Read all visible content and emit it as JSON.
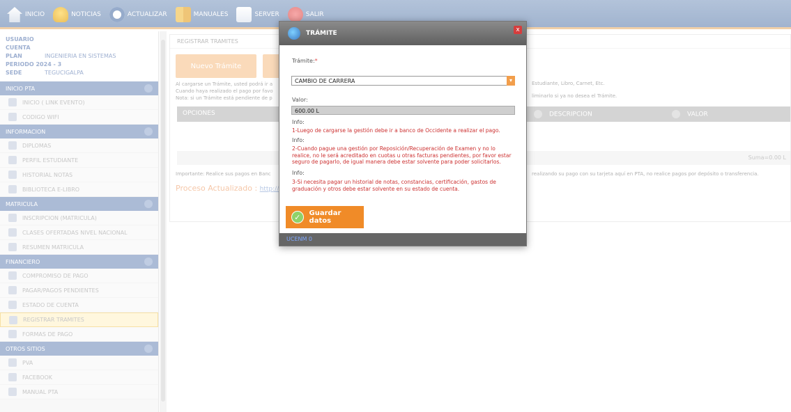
{
  "nav": {
    "inicio": "INICIO",
    "noticias": "NOTICIAS",
    "actualizar": "ACTUALIZAR",
    "manuales": "MANUALES",
    "server": "SERVER",
    "salir": "SALIR"
  },
  "user": {
    "usuario": "USUARIO",
    "cuenta": "CUENTA",
    "plan_label": "PLAN",
    "plan_value": "INGENIERIA EN SISTEMAS",
    "periodo": "PERIODO 2024 - 3",
    "sede_label": "SEDE",
    "sede_value": "TEGUCIGALPA"
  },
  "sidebar": {
    "sections": [
      {
        "title": "INICIO PTA",
        "items": [
          "INICIO ( LINK EVENTO)",
          "CODIGO WIFI"
        ]
      },
      {
        "title": "INFORMACION",
        "items": [
          "DIPLOMAS",
          "PERFIL ESTUDIANTE",
          "HISTORIAL NOTAS",
          "BIBLIOTECA E-LIBRO"
        ]
      },
      {
        "title": "MATRICULA",
        "items": [
          "INSCRIPCION (MATRICULA)",
          "CLASES OFERTADAS NIVEL NACIONAL",
          "RESUMEN MATRICULA"
        ]
      },
      {
        "title": "FINANCIERO",
        "items": [
          "COMPROMISO DE PAGO",
          "PAGAR/PAGOS PENDIENTES",
          "ESTADO DE CUENTA",
          "REGISTRAR TRAMITES",
          "FORMAS DE PAGO"
        ]
      },
      {
        "title": "OTROS SITIOS",
        "items": [
          "PVA",
          "FACEBOOK",
          "MANUAL PTA"
        ]
      }
    ]
  },
  "main": {
    "title": "REGISTRAR TRAMITES",
    "new_button": "Nuevo Trámite",
    "note1": "Al cargarse un Trámite, usted podrá ir a",
    "note2": "Cuando haya realizado el pago por favo",
    "note3": "Nota: si un Trámite está pendiente de p",
    "note_r1": "Estudiante, Libro, Carnet, Etc.",
    "note_r2": "liminarlo si ya no desea el Trámite.",
    "col_opciones": "OPCIONES",
    "col_descripcion": "DESCRIPCION",
    "col_valor": "VALOR",
    "suma": "Suma=0.00 L",
    "important": "Importante: Realice sus pagos en Banc",
    "important_r": "realizando su pago con su tarjeta aquí en PTA, no realice pagos por depósito o transferencia.",
    "proceso": "Proceso Actualizado :",
    "proceso_link": "http://ww"
  },
  "modal": {
    "title": "TRÁMITE",
    "close": "x",
    "tramite_label": "Trámite:",
    "required": "*",
    "tramite_value": "CAMBIO DE CARRERA",
    "valor_label": "Valor:",
    "valor_value": "600.00 L",
    "info_label": "Info:",
    "info1": "1-Luego de cargarse la gestión debe ir a banco de Occidente a realizar el pago.",
    "info2": "2-Cuando pague una gestión por Reposición/Recuperación de Examen y no lo realice, no le será acreditado en cuotas u otras facturas pendientes, por favor estar seguro de pagarlo, de igual manera debe estar solvente para poder solicitarlos.",
    "info3": "3-Si necesita pagar un historial de notas, constancias, certificación, gastos de graduación y otros debe estar solvente en su estado de cuenta.",
    "save": "Guardar datos",
    "footer": "UCENM 0"
  }
}
